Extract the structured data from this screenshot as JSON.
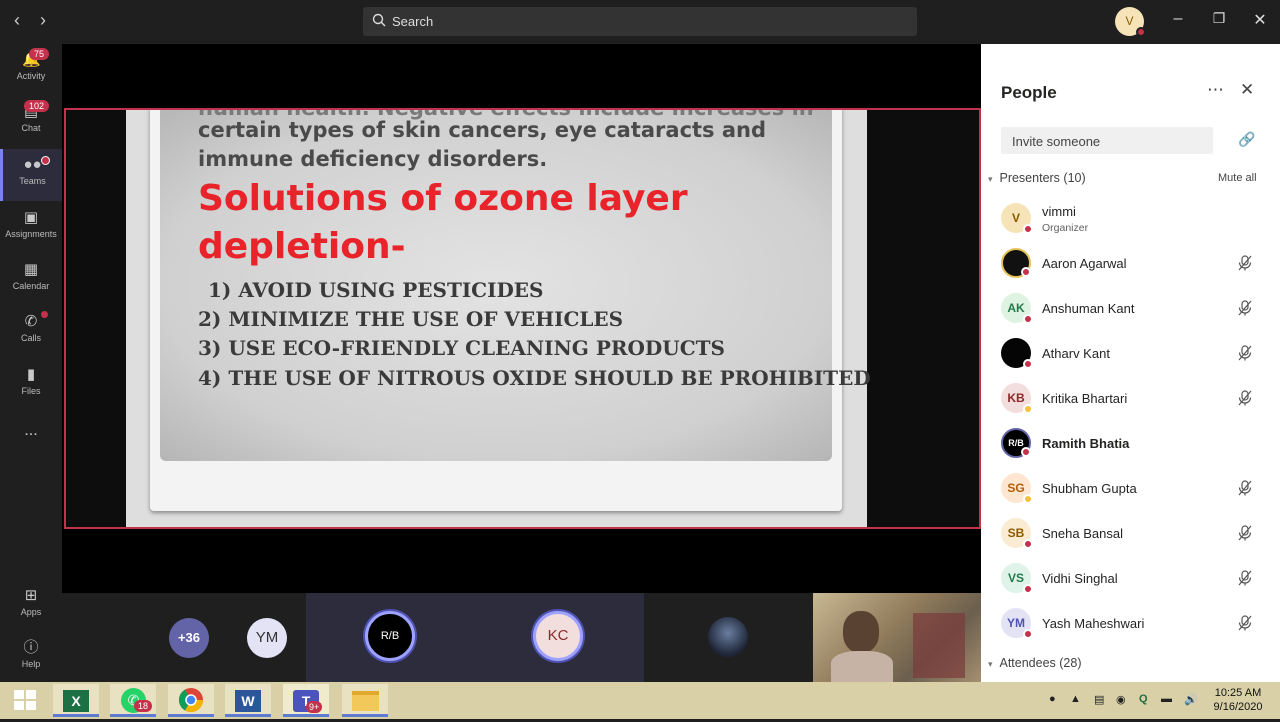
{
  "titlebar": {
    "search_placeholder": "Search",
    "me_initial": "V"
  },
  "rail": {
    "items": [
      {
        "label": "Activity",
        "badge": "75"
      },
      {
        "label": "Chat",
        "badge": "102"
      },
      {
        "label": "Teams"
      },
      {
        "label": "Assignments"
      },
      {
        "label": "Calendar"
      },
      {
        "label": "Calls"
      },
      {
        "label": "Files"
      },
      {
        "label": "Apps"
      },
      {
        "label": "Help"
      }
    ],
    "more": "..."
  },
  "slide": {
    "cut_line": "human health. Negative effects include increases in",
    "line1": "certain types of skin cancers, eye cataracts and",
    "line2": "immune deficiency disorders.",
    "heading1": "Solutions of ozone layer",
    "heading2": "depletion-",
    "list": [
      "1) AVOID USING PESTICIDES",
      "2) MINIMIZE THE USE OF VEHICLES",
      "3) USE ECO-FRIENDLY CLEANING PRODUCTS",
      "4) THE USE OF NITROUS OXIDE SHOULD BE PROHIBITED"
    ]
  },
  "strip": {
    "overflow": "+36",
    "tiles": [
      "YM",
      "R/B",
      "KC"
    ]
  },
  "panel": {
    "title": "People",
    "invite_placeholder": "Invite someone",
    "presenters_label": "Presenters (10)",
    "mute_all": "Mute all",
    "attendees_label": "Attendees (28)",
    "people": [
      {
        "initials": "V",
        "name": "vimmi",
        "sub": "Organizer",
        "bg": "#f6e4b8",
        "fg": "#8a5a00",
        "status": "#c4314b",
        "mic": false
      },
      {
        "initials": "",
        "name": "Aaron Agarwal",
        "bg": "#111111",
        "fg": "#e6c25a",
        "status": "#c4314b",
        "mic": true
      },
      {
        "initials": "AK",
        "name": "Anshuman Kant",
        "bg": "#dff3e3",
        "fg": "#237b4b",
        "status": "#c4314b",
        "mic": true
      },
      {
        "initials": "",
        "name": "Atharv Kant",
        "bg": "#050505",
        "fg": "#ffffff",
        "status": "#c4314b",
        "mic": true
      },
      {
        "initials": "KB",
        "name": "Kritika Bhartari",
        "bg": "#f3dede",
        "fg": "#8a2a2a",
        "status": "#f8c13b",
        "mic": true
      },
      {
        "initials": "R/B",
        "name": "Ramith Bhatia",
        "bg": "#000000",
        "fg": "#ffffff",
        "status": "#c4314b",
        "mic": false,
        "bold": true
      },
      {
        "initials": "SG",
        "name": "Shubham Gupta",
        "bg": "#fde7d0",
        "fg": "#b45d0b",
        "status": "#f8c13b",
        "mic": true
      },
      {
        "initials": "SB",
        "name": "Sneha Bansal",
        "bg": "#f9ecd3",
        "fg": "#8a5a00",
        "status": "#c4314b",
        "mic": true
      },
      {
        "initials": "VS",
        "name": "Vidhi Singhal",
        "bg": "#dff3ea",
        "fg": "#237b4b",
        "status": "#c4314b",
        "mic": true
      },
      {
        "initials": "YM",
        "name": "Yash Maheshwari",
        "bg": "#e4e3f6",
        "fg": "#4f52b2",
        "status": "#c4314b",
        "mic": true
      }
    ]
  },
  "taskbar": {
    "time": "10:25 AM",
    "date": "9/16/2020",
    "whatsapp_badge": "18",
    "teams_badge": "9+",
    "apps": [
      "start",
      "excel",
      "whatsapp",
      "chrome",
      "word",
      "teams",
      "explorer"
    ]
  },
  "colors": {
    "accent": "#6264a7",
    "alert": "#c4314b",
    "slide_heading": "#e8232a"
  }
}
